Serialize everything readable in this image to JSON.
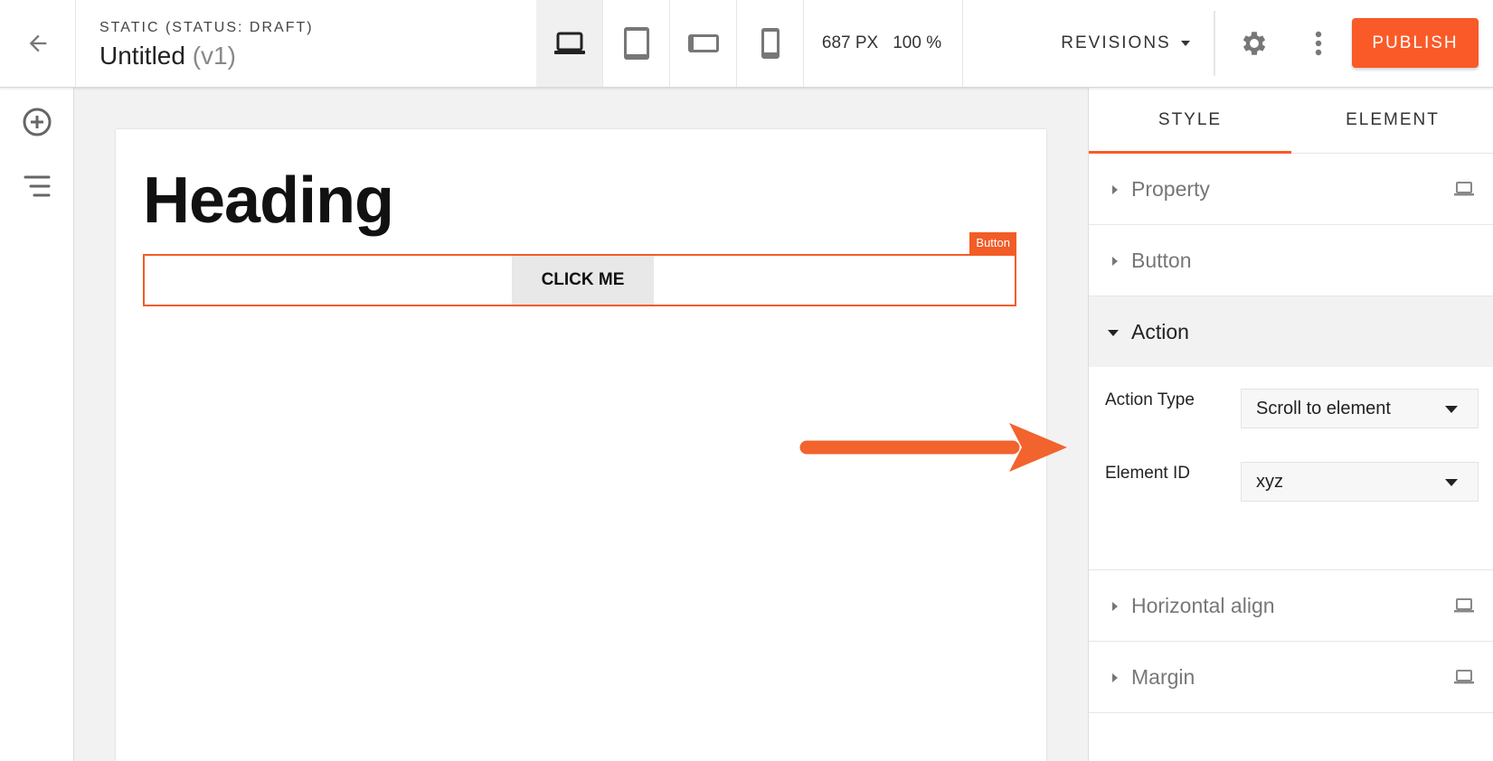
{
  "header": {
    "status_line": "STATIC (STATUS: DRAFT)",
    "title": "Untitled",
    "version": "(v1)",
    "width": "687 PX",
    "zoom": "100 %",
    "revisions_label": "REVISIONS",
    "publish_label": "PUBLISH",
    "devices": [
      "laptop-icon",
      "tablet-icon",
      "tablet-landscape-icon",
      "phone-icon"
    ],
    "active_device": "laptop-icon"
  },
  "left_rail": {
    "items": [
      "add-circle-icon",
      "layers-list-icon"
    ]
  },
  "canvas": {
    "heading": "Heading",
    "selection_tag": "Button",
    "button_label": "CLICK ME"
  },
  "panel": {
    "tabs": [
      {
        "label": "STYLE",
        "active": true
      },
      {
        "label": "ELEMENT",
        "active": false
      }
    ],
    "sections": {
      "property": "Property",
      "button": "Button",
      "action": "Action",
      "horizontal_align": "Horizontal align",
      "margin": "Margin"
    },
    "action": {
      "type_label": "Action Type",
      "type_value": "Scroll to element",
      "element_id_label": "Element ID",
      "element_id_value": "xyz"
    }
  },
  "colors": {
    "accent": "#fa5a28",
    "selection": "#f25c27",
    "arrow": "#f2632e"
  }
}
